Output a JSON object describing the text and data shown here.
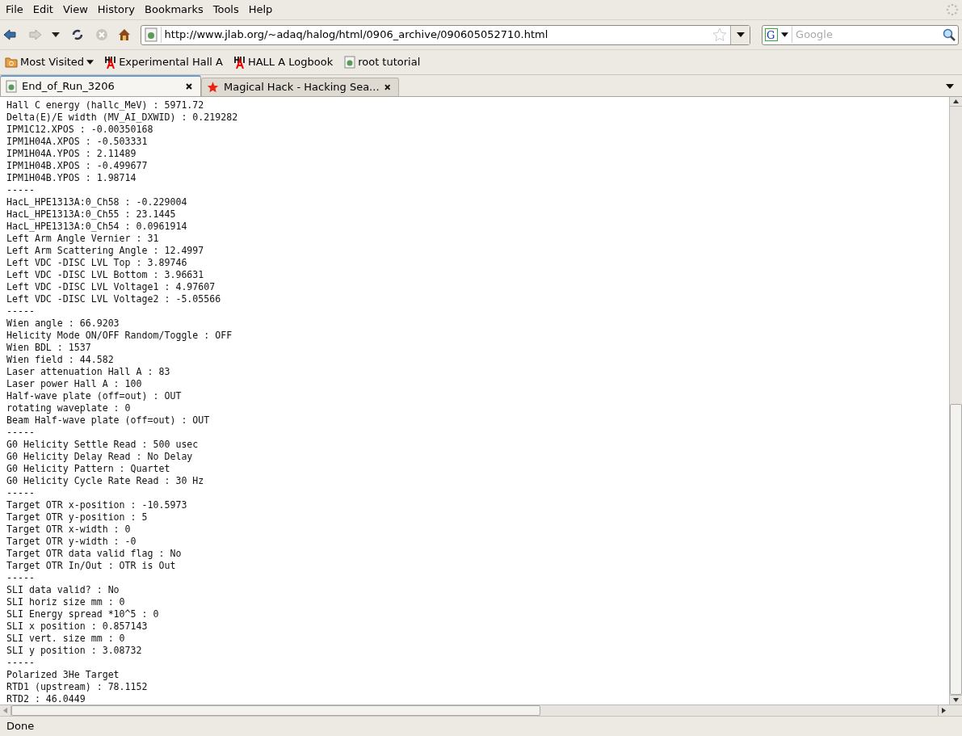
{
  "menu": [
    "File",
    "Edit",
    "View",
    "History",
    "Bookmarks",
    "Tools",
    "Help"
  ],
  "address": {
    "value": "http://www.jlab.org/~adaq/halog/html/0906_archive/090605052710.html"
  },
  "search": {
    "engine_logo": "G",
    "placeholder": "Google"
  },
  "bookmarks": [
    {
      "kind": "folder",
      "label": "Most Visited"
    },
    {
      "kind": "hall",
      "label": "Experimental Hall A"
    },
    {
      "kind": "hall",
      "label": "HALL A Logbook"
    },
    {
      "kind": "page",
      "label": "root tutorial"
    }
  ],
  "tabs": [
    {
      "label": "End_of_Run_3206",
      "selected": true,
      "kind": "page"
    },
    {
      "label": "Magical Hack - Hacking Sea...",
      "selected": false,
      "kind": "star"
    }
  ],
  "lines": [
    "Hall C energy (hallc_MeV) : 5971.72",
    "Delta(E)/E width (MV_AI_DXWID) : 0.219282",
    "IPM1C12.XPOS : -0.00350168",
    "IPM1H04A.XPOS : -0.503331",
    "IPM1H04A.YPOS : 2.11489",
    "IPM1H04B.XPOS : -0.499677",
    "IPM1H04B.YPOS : 1.98714",
    "-----",
    "HacL_HPE1313A:0_Ch58 : -0.229004",
    "HacL_HPE1313A:0_Ch55 : 23.1445",
    "HacL_HPE1313A:0_Ch54 : 0.0961914",
    "Left Arm Angle Vernier : 31",
    "Left Arm Scattering Angle : 12.4997",
    "Left VDC -DISC LVL Top : 3.89746",
    "Left VDC -DISC LVL Bottom : 3.96631",
    "Left VDC -DISC LVL Voltage1 : 4.97607",
    "Left VDC -DISC LVL Voltage2 : -5.05566",
    "-----",
    "Wien angle : 66.9203",
    "Helicity Mode ON/OFF Random/Toggle : OFF",
    "Wien BDL : 1537",
    "Wien field : 44.582",
    "Laser attenuation Hall A : 83",
    "Laser power Hall A : 100",
    "Half-wave plate (off=out) : OUT",
    "rotating waveplate : 0",
    "Beam Half-wave plate (off=out) : OUT",
    "-----",
    "G0 Helicity Settle Read : 500 usec",
    "G0 Helicity Delay Read : No Delay",
    "G0 Helicity Pattern : Quartet",
    "G0 Helicity Cycle Rate Read : 30 Hz",
    "-----",
    "Target OTR x-position : -10.5973",
    "Target OTR y-position : 5",
    "Target OTR x-width : 0",
    "Target OTR y-width : -0",
    "Target OTR data valid flag : No",
    "Target OTR In/Out : OTR is Out",
    "-----",
    "SLI data valid? : No",
    "SLI horiz size mm : 0",
    "SLI Energy spread *10^5 : 0",
    "SLI x position : 0.857143",
    "SLI vert. size mm : 0",
    "SLI y position : 3.08732",
    "-----",
    "Polarized 3He Target",
    "RTD1 (upstream) : 78.1152",
    "RTD2 : 46.0449"
  ],
  "status_bar": "Done"
}
